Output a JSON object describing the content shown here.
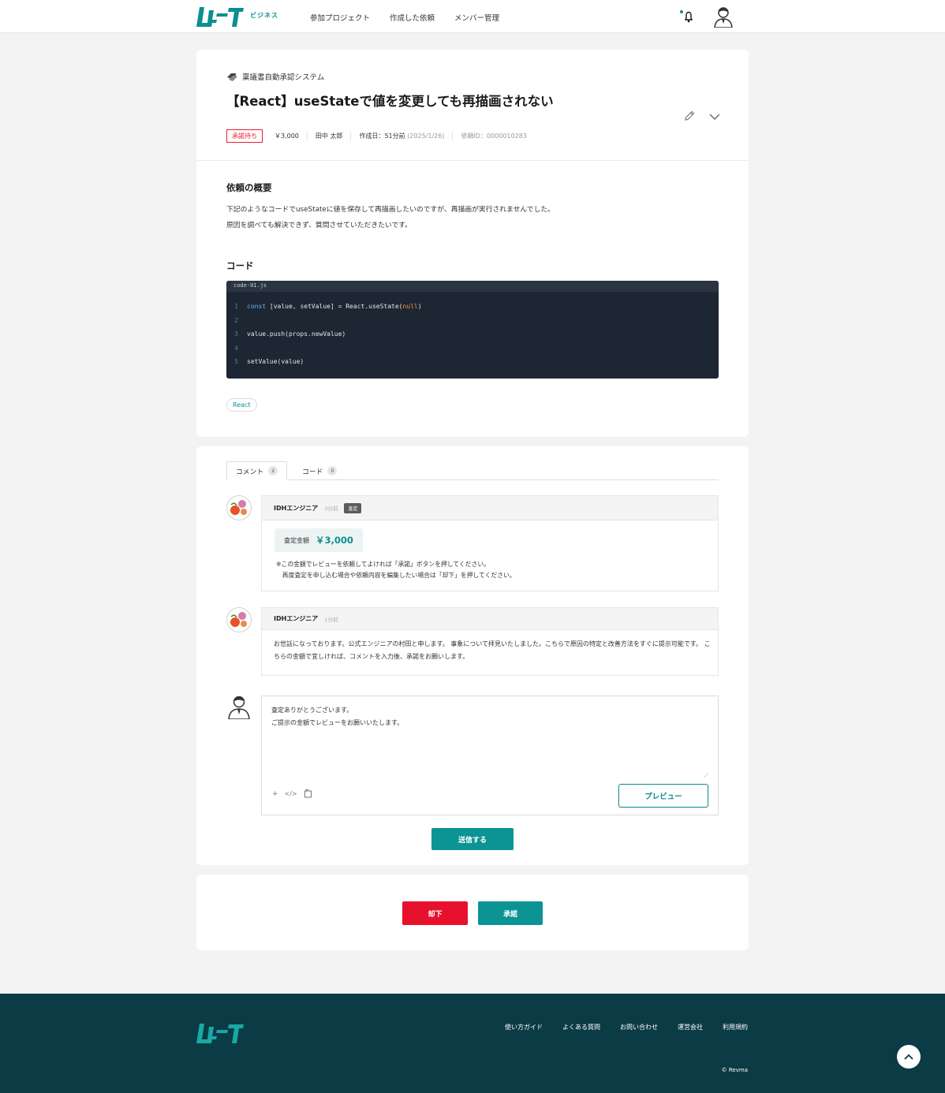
{
  "brand": {
    "logo_text": "レビュー",
    "sub_label": "ビジネス"
  },
  "nav": [
    "参加プロジェクト",
    "作成した依頼",
    "メンバー管理"
  ],
  "request": {
    "project_name": "稟議書自動承認システム",
    "title": "【React】useStateで値を変更しても再描画されない",
    "status": "承諾待ち",
    "price": "￥3,000",
    "requester": "田中 太郎",
    "created_label": "作成日：51分前",
    "created_date": "(2025/1/26)",
    "request_id": "依頼ID：0000010283"
  },
  "overview": {
    "heading": "依頼の概要",
    "lines": [
      "下記のようなコードでuseStateに値を保存して再描画したいのですが、再描画が実行されませんでした。",
      "原因を調べても解決できず、質問させていただきたいです。"
    ]
  },
  "code_section": {
    "heading": "コード",
    "filename": "code-01.js",
    "line_numbers": [
      "1",
      "2",
      "3",
      "4",
      "5"
    ],
    "line1": {
      "kw": "const",
      "rest": " [value, setValue] = React.useState(",
      "null": "null",
      "end": ")"
    },
    "line3": "value.push(props.newValue)",
    "line5": "setValue(value)"
  },
  "tags": [
    "React"
  ],
  "tabs": [
    {
      "label": "コメント",
      "count": "2"
    },
    {
      "label": "コード",
      "count": "0"
    }
  ],
  "comments": [
    {
      "author": "IDHエンジニア",
      "time": "3分前",
      "badge": "査定",
      "assess_label": "査定金額",
      "assess_value": "￥3,000",
      "note_line1": "※この金額でレビューを依頼してよければ「承諾」ボタンを押してください。",
      "note_line2": "　再度査定を申し込む場合や依頼内容を編集したい場合は「却下」を押してください。"
    },
    {
      "author": "IDHエンジニア",
      "time": "1分前",
      "body": "お世話になっております。公式エンジニアの村田と申します。 事象について拝見いたしました。こちらで原因の特定と改善方法をすぐに提示可能です。 こちらの金額で宜しければ、コメントを入力後、承諾をお願いします。"
    }
  ],
  "composer": {
    "text": "査定ありがとうございます。\nご提示の金額でレビューをお願いいたします。",
    "tool_icons": [
      "plus-icon",
      "code-icon",
      "attach-icon"
    ],
    "preview_label": "プレビュー",
    "send_label": "送信する"
  },
  "actions": {
    "reject_label": "却下",
    "approve_label": "承諾"
  },
  "footer": {
    "links": [
      "使い方ガイド",
      "よくある質問",
      "お問い合わせ",
      "運営会社",
      "利用規約"
    ],
    "copyright": "© Revma"
  },
  "colors": {
    "brand": "#0c8f8f",
    "danger": "#e8112d",
    "footer_bg": "#0b3b45"
  }
}
